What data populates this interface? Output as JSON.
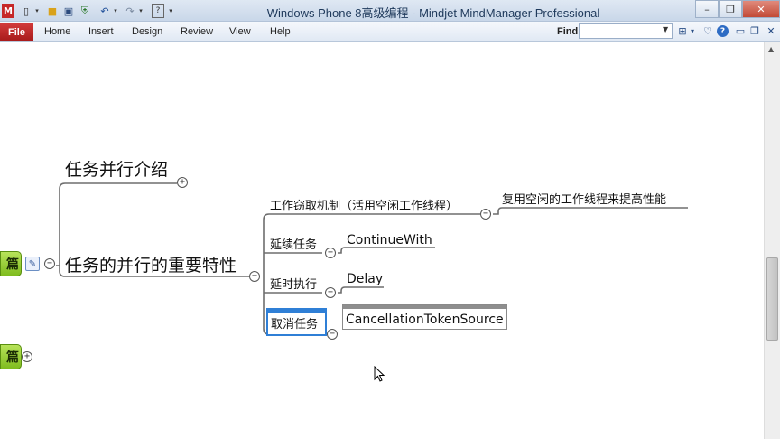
{
  "window": {
    "title": "Windows Phone 8高级编程 - Mindjet MindManager Professional",
    "controls": {
      "minimize": "–",
      "restore": "❐",
      "close": "✕"
    }
  },
  "quick_access": {
    "icons": [
      "app-logo-icon",
      "new-document-icon",
      "open-folder-icon",
      "save-icon",
      "shield-icon",
      "undo-icon",
      "redo-icon",
      "help-box-icon"
    ]
  },
  "ribbon": {
    "file_label": "File",
    "tabs": [
      "Home",
      "Insert",
      "Design",
      "Review",
      "View",
      "Help"
    ],
    "find_label": "Find:",
    "find_value": "",
    "right_icons": [
      "binoculars-icon",
      "dropdown-icon",
      "heart-icon",
      "help-icon",
      "minimize-ribbon-icon",
      "restore-ribbon-icon",
      "close-ribbon-icon"
    ]
  },
  "mindmap": {
    "left_boxes": [
      {
        "label": "篇",
        "collapsed": false
      },
      {
        "label": "篇",
        "collapsed": true
      }
    ],
    "main_topics": [
      {
        "label": "任务并行介绍",
        "collapsed": true
      },
      {
        "label": "任务的并行的重要特性",
        "collapsed": false
      }
    ],
    "subtopics": [
      {
        "label": "工作窃取机制（活用空闲工作线程）",
        "child": "复用空闲的工作线程来提高性能"
      },
      {
        "label": "延续任务",
        "child": "ContinueWith"
      },
      {
        "label": "延时执行",
        "child": "Delay"
      },
      {
        "label": "取消任务",
        "child": "CancellationTokenSource"
      }
    ]
  },
  "colors": {
    "branch_line": "#6e6e6e",
    "selection": "#2f7fd6",
    "central_box": "#8fca2a",
    "file_tab": "#c12b2b"
  }
}
